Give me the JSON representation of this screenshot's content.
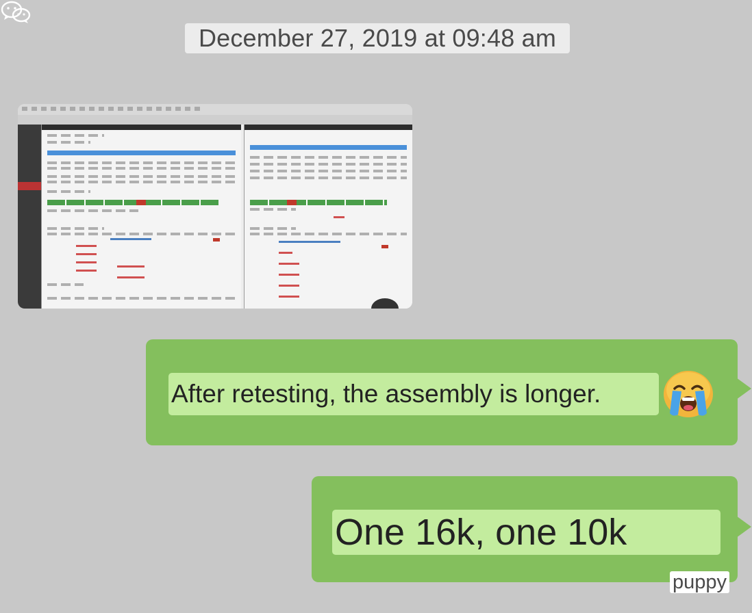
{
  "timestamp": "December 27, 2019 at 09:48 am",
  "messages": [
    {
      "text": "After retesting, the assembly is longer.",
      "emoji": "loudly-crying-face"
    },
    {
      "text": "One 16k, one 10k"
    }
  ],
  "watermark": {
    "label": "puppy",
    "icon": "wechat-icon"
  },
  "colors": {
    "background": "#c8c8c8",
    "bubble": "#84bf5d",
    "highlight": "#c3ec9e"
  }
}
